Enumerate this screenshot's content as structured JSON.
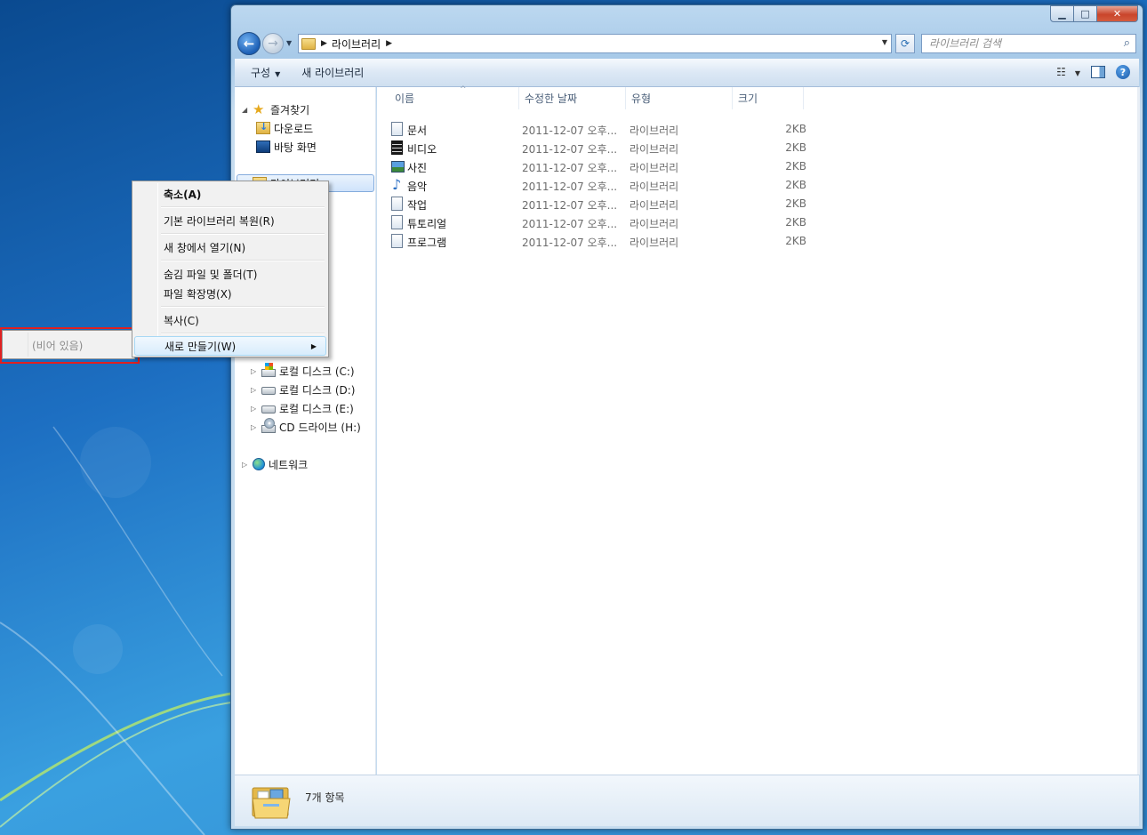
{
  "window": {
    "caption_buttons": {
      "minimize_icon": "minimize-icon",
      "maximize_icon": "maximize-icon",
      "close_icon": "close-icon"
    }
  },
  "address_bar": {
    "crumbs": [
      "라이브러리"
    ],
    "search_placeholder": "라이브러리 검색"
  },
  "command_bar": {
    "organize": "구성",
    "new_library": "새 라이브러리"
  },
  "nav_pane": {
    "favorites": "즐겨찾기",
    "downloads": "다운로드",
    "desktop": "바탕 화면",
    "libraries": "라이브러리",
    "drives": [
      "로컬 디스크 (C:)",
      "로컬 디스크 (D:)",
      "로컬 디스크 (E:)",
      "CD 드라이브 (H:)"
    ],
    "network": "네트워크"
  },
  "columns": {
    "name": "이름",
    "date": "수정한 날짜",
    "type": "유형",
    "size": "크기"
  },
  "files": [
    {
      "name": "문서",
      "date": "2011-12-07 오후...",
      "type": "라이브러리",
      "size": "2KB",
      "icon": "document-library-icon"
    },
    {
      "name": "비디오",
      "date": "2011-12-07 오후...",
      "type": "라이브러리",
      "size": "2KB",
      "icon": "video-library-icon"
    },
    {
      "name": "사진",
      "date": "2011-12-07 오후...",
      "type": "라이브러리",
      "size": "2KB",
      "icon": "picture-library-icon"
    },
    {
      "name": "음악",
      "date": "2011-12-07 오후...",
      "type": "라이브러리",
      "size": "2KB",
      "icon": "music-library-icon"
    },
    {
      "name": "작업",
      "date": "2011-12-07 오후...",
      "type": "라이브러리",
      "size": "2KB",
      "icon": "library-icon"
    },
    {
      "name": "튜토리얼",
      "date": "2011-12-07 오후...",
      "type": "라이브러리",
      "size": "2KB",
      "icon": "library-icon"
    },
    {
      "name": "프로그램",
      "date": "2011-12-07 오후...",
      "type": "라이브러리",
      "size": "2KB",
      "icon": "library-icon"
    }
  ],
  "status": {
    "count": "7개 항목"
  },
  "context_menu": {
    "collapse": "축소(A)",
    "restore_default": "기본 라이브러리 복원(R)",
    "open_new_window": "새 창에서 열기(N)",
    "hidden_files": "숨김 파일 및 폴더(T)",
    "file_extensions": "파일 확장명(X)",
    "copy": "복사(C)",
    "new": "새로 만들기(W)"
  },
  "submenu": {
    "empty": "(비어 있음)"
  },
  "colors": {
    "highlight_box": "#e02020",
    "desktop_blue": "#1d6fc2"
  }
}
